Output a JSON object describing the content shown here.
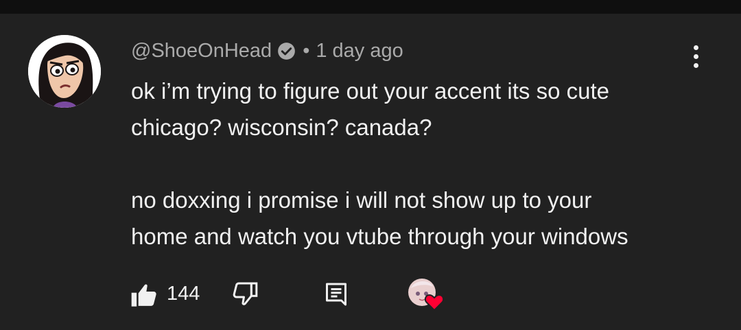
{
  "comment": {
    "author": "@ShoeOnHead",
    "verified": true,
    "separator": "•",
    "time": "1 day ago",
    "lines": [
      "ok i’m trying to figure out your accent its so cute",
      "chicago? wisconsin? canada?",
      "",
      "no doxxing i promise i will not show up to your",
      "home and watch you vtube through your windows"
    ]
  },
  "actions": {
    "like_count": "144",
    "hearted_by_creator": true
  },
  "icons": {
    "verified": "verified-check-icon",
    "more": "more-vertical-icon",
    "like": "thumbs-up-icon",
    "dislike": "thumbs-down-icon",
    "reply": "reply-comment-icon",
    "heart": "heart-icon"
  },
  "colors": {
    "background": "#212121",
    "text_primary": "#f1f1f1",
    "text_secondary": "#aaaaaa",
    "heart": "#ff0033"
  }
}
